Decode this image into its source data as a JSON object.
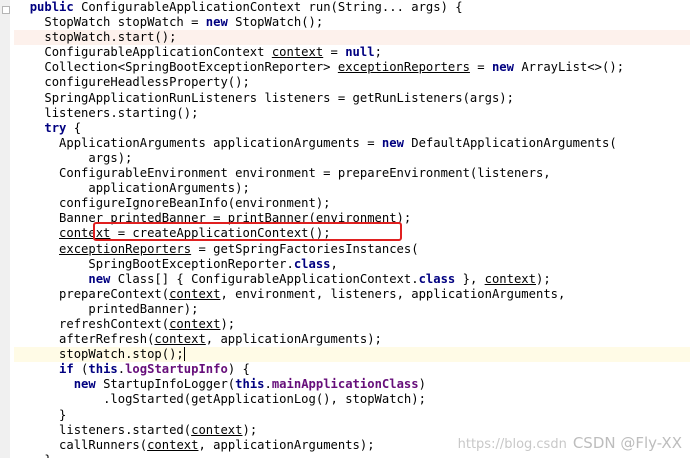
{
  "editor": {
    "lines": [
      {
        "indent": 2,
        "style": "",
        "tokens": [
          [
            "kw",
            "public "
          ],
          [
            "",
            "ConfigurableApplicationContext run(String... args) {"
          ]
        ]
      },
      {
        "indent": 4,
        "style": "",
        "tokens": [
          [
            "",
            "StopWatch stopWatch = "
          ],
          [
            "kw",
            "new "
          ],
          [
            "",
            "StopWatch();"
          ]
        ]
      },
      {
        "indent": 4,
        "style": "hl",
        "tokens": [
          [
            "",
            "stopWatch.start();"
          ]
        ]
      },
      {
        "indent": 4,
        "style": "",
        "tokens": [
          [
            "",
            "ConfigurableApplicationContext "
          ],
          [
            "var",
            "context"
          ],
          [
            "",
            " = "
          ],
          [
            "kw",
            "null"
          ],
          [
            "",
            ";"
          ]
        ]
      },
      {
        "indent": 4,
        "style": "",
        "tokens": [
          [
            "",
            "Collection<SpringBootExceptionReporter> "
          ],
          [
            "var",
            "exceptionReporters"
          ],
          [
            "",
            " = "
          ],
          [
            "kw",
            "new "
          ],
          [
            "",
            "ArrayList<>();"
          ]
        ]
      },
      {
        "indent": 4,
        "style": "",
        "tokens": [
          [
            "",
            "configureHeadlessProperty();"
          ]
        ]
      },
      {
        "indent": 4,
        "style": "",
        "tokens": [
          [
            "",
            "SpringApplicationRunListeners listeners = getRunListeners(args);"
          ]
        ]
      },
      {
        "indent": 4,
        "style": "",
        "tokens": [
          [
            "",
            "listeners.starting();"
          ]
        ]
      },
      {
        "indent": 4,
        "style": "",
        "tokens": [
          [
            "kw",
            "try "
          ],
          [
            "",
            "{"
          ]
        ]
      },
      {
        "indent": 6,
        "style": "",
        "tokens": [
          [
            "",
            "ApplicationArguments applicationArguments = "
          ],
          [
            "kw",
            "new "
          ],
          [
            "",
            "DefaultApplicationArguments("
          ]
        ]
      },
      {
        "indent": 10,
        "style": "",
        "tokens": [
          [
            "",
            "args);"
          ]
        ]
      },
      {
        "indent": 6,
        "style": "",
        "tokens": [
          [
            "",
            "ConfigurableEnvironment environment = prepareEnvironment(listeners,"
          ]
        ]
      },
      {
        "indent": 10,
        "style": "",
        "tokens": [
          [
            "",
            "applicationArguments);"
          ]
        ]
      },
      {
        "indent": 6,
        "style": "",
        "tokens": [
          [
            "",
            "configureIgnoreBeanInfo(environment);"
          ]
        ]
      },
      {
        "indent": 6,
        "style": "",
        "tokens": [
          [
            "",
            "Banner printedBanner = printBanner(environment);"
          ]
        ]
      },
      {
        "indent": 6,
        "style": "",
        "tokens": [
          [
            "var",
            "context"
          ],
          [
            "",
            " = createApplicationContext();"
          ]
        ]
      },
      {
        "indent": 6,
        "style": "",
        "tokens": [
          [
            "var",
            "exceptionReporters"
          ],
          [
            "",
            " = getSpringFactoriesInstances("
          ]
        ]
      },
      {
        "indent": 10,
        "style": "",
        "tokens": [
          [
            "",
            "SpringBootExceptionReporter."
          ],
          [
            "kw",
            "class"
          ],
          [
            "",
            ","
          ]
        ]
      },
      {
        "indent": 10,
        "style": "",
        "tokens": [
          [
            "kw",
            "new "
          ],
          [
            "",
            "Class[] { ConfigurableApplicationContext."
          ],
          [
            "kw",
            "class "
          ],
          [
            "",
            "}, "
          ],
          [
            "var",
            "context"
          ],
          [
            "",
            ");"
          ]
        ]
      },
      {
        "indent": 6,
        "style": "",
        "tokens": [
          [
            "",
            "prepareContext("
          ],
          [
            "var",
            "context"
          ],
          [
            "",
            ", environment, listeners, applicationArguments,"
          ]
        ]
      },
      {
        "indent": 10,
        "style": "",
        "tokens": [
          [
            "",
            "printedBanner);"
          ]
        ]
      },
      {
        "indent": 6,
        "style": "",
        "tokens": [
          [
            "",
            "refreshContext("
          ],
          [
            "var",
            "context"
          ],
          [
            "",
            ");"
          ]
        ]
      },
      {
        "indent": 6,
        "style": "",
        "tokens": [
          [
            "",
            "afterRefresh("
          ],
          [
            "var",
            "context"
          ],
          [
            "",
            ", applicationArguments);"
          ]
        ]
      },
      {
        "indent": 6,
        "style": "cur",
        "tokens": [
          [
            "",
            "stopWatch.stop();"
          ],
          [
            "caret",
            ""
          ]
        ]
      },
      {
        "indent": 6,
        "style": "",
        "tokens": [
          [
            "kw",
            "if "
          ],
          [
            "",
            "("
          ],
          [
            "kw",
            "this"
          ],
          [
            "",
            "."
          ],
          [
            "field",
            "logStartupInfo"
          ],
          [
            "",
            ") {"
          ]
        ]
      },
      {
        "indent": 8,
        "style": "",
        "tokens": [
          [
            "kw",
            "new "
          ],
          [
            "",
            "StartupInfoLogger("
          ],
          [
            "kw",
            "this"
          ],
          [
            "",
            "."
          ],
          [
            "field",
            "mainApplicationClass"
          ],
          [
            "",
            ")"
          ]
        ]
      },
      {
        "indent": 12,
        "style": "",
        "tokens": [
          [
            "",
            ".logStarted(getApplicationLog(), stopWatch);"
          ]
        ]
      },
      {
        "indent": 6,
        "style": "",
        "tokens": [
          [
            "",
            "}"
          ]
        ]
      },
      {
        "indent": 6,
        "style": "",
        "tokens": [
          [
            "",
            "listeners.started("
          ],
          [
            "var",
            "context"
          ],
          [
            "",
            ");"
          ]
        ]
      },
      {
        "indent": 6,
        "style": "",
        "tokens": [
          [
            "",
            "callRunners("
          ],
          [
            "var",
            "context"
          ],
          [
            "",
            ", applicationArguments);"
          ]
        ]
      },
      {
        "indent": 4,
        "style": "",
        "tokens": [
          [
            "",
            "}"
          ]
        ]
      }
    ]
  },
  "annotation": {
    "label": "highlight-box"
  },
  "watermark": {
    "url": "https://blog.csdn",
    "brand": "CSDN @Fly-XX"
  },
  "colors": {
    "keyword": "#000080",
    "field": "#660e7a",
    "highlight_line": "#fdf1ec",
    "current_line": "#fffbe6",
    "box": "#e02020"
  }
}
